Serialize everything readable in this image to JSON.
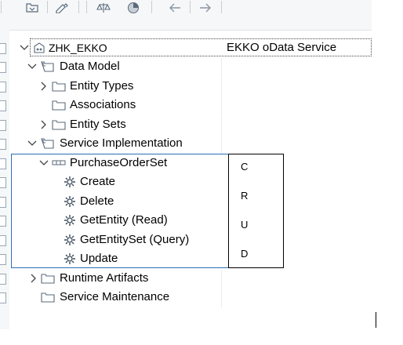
{
  "toolbar": {
    "buttons": [
      "folder-tree-icon",
      "edit-icon",
      "balance-icon",
      "pie-chart-icon",
      "back-arrow-icon",
      "forward-arrow-icon"
    ]
  },
  "tree": {
    "root": {
      "label": "ZHK_EKKO",
      "description": "EKKO oData Service"
    },
    "data_model": "Data Model",
    "entity_types": "Entity Types",
    "associations": "Associations",
    "entity_sets": "Entity Sets",
    "service_implementation": "Service Implementation",
    "entity_set": "PurchaseOrderSet",
    "operations": [
      "Create",
      "Delete",
      "GetEntity (Read)",
      "GetEntitySet (Query)",
      "Update"
    ],
    "runtime_artifacts": "Runtime Artifacts",
    "service_maintenance": "Service Maintenance"
  },
  "crud": [
    "C",
    "R",
    "U",
    "D"
  ],
  "colors": {
    "highlight_border": "#2b6eb7",
    "folder": "#5a6a7a"
  }
}
